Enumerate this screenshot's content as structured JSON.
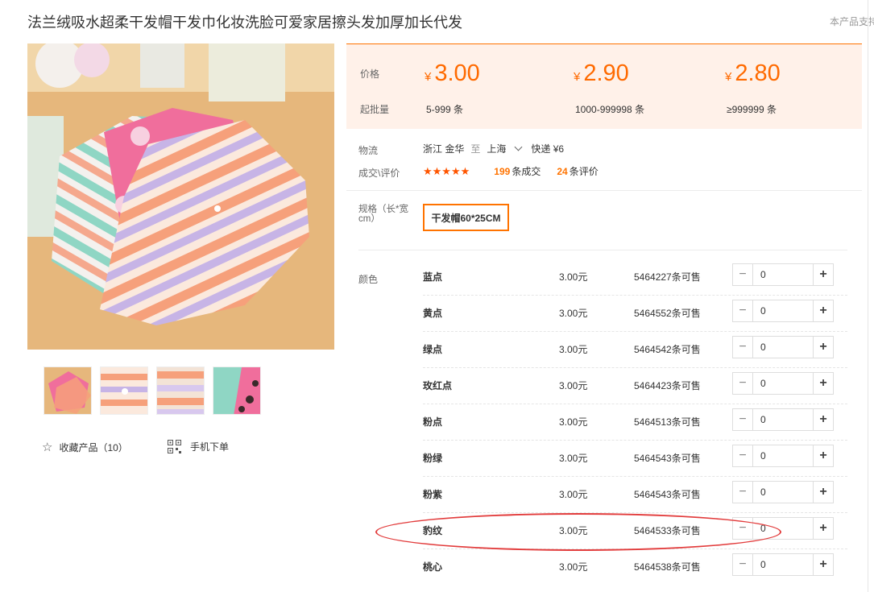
{
  "title": "法兰绒吸水超柔干发帽干发巾化妆洗脸可爱家居擦头发加厚加长代发",
  "support_text": "本产品支持",
  "gallery": {
    "thumb_count": 4
  },
  "actions": {
    "favorite": "收藏产品（10）",
    "mobile_order": "手机下单"
  },
  "price": {
    "label": "价格",
    "moq_label": "起批量",
    "currency": "¥",
    "tiers": [
      {
        "price": "3.00",
        "range": "5-999 条"
      },
      {
        "price": "2.90",
        "range": "1000-999998 条"
      },
      {
        "price": "2.80",
        "range": "≥999999 条"
      }
    ]
  },
  "logistics": {
    "label": "物流",
    "from": "浙江 金华",
    "to_word": "至",
    "to": "上海",
    "express": "快递 ¥6"
  },
  "trade": {
    "label": "成交\\评价",
    "stars": "★★★★★",
    "deals_count": "199",
    "deals_unit": "条成交",
    "reviews_count": "24",
    "reviews_unit": "条评价"
  },
  "spec": {
    "label": "规格（长*宽cm）",
    "option": "干发帽60*25CM"
  },
  "colors": {
    "label": "颜色",
    "items": [
      {
        "name": "蓝点",
        "price": "3.00元",
        "stock": "5464227条可售",
        "qty": "0"
      },
      {
        "name": "黄点",
        "price": "3.00元",
        "stock": "5464552条可售",
        "qty": "0"
      },
      {
        "name": "绿点",
        "price": "3.00元",
        "stock": "5464542条可售",
        "qty": "0"
      },
      {
        "name": "玫红点",
        "price": "3.00元",
        "stock": "5464423条可售",
        "qty": "0"
      },
      {
        "name": "粉点",
        "price": "3.00元",
        "stock": "5464513条可售",
        "qty": "0"
      },
      {
        "name": "粉绿",
        "price": "3.00元",
        "stock": "5464543条可售",
        "qty": "0"
      },
      {
        "name": "粉紫",
        "price": "3.00元",
        "stock": "5464543条可售",
        "qty": "0"
      },
      {
        "name": "豹纹",
        "price": "3.00元",
        "stock": "5464533条可售",
        "qty": "0"
      },
      {
        "name": "桃心",
        "price": "3.00元",
        "stock": "5464538条可售",
        "qty": "0"
      }
    ]
  },
  "stepper": {
    "minus": "−",
    "plus": "+"
  },
  "colors_theme": {
    "accent": "#ff6a00",
    "price_bg": "#fff1e9",
    "highlight": "#e23c3c"
  }
}
